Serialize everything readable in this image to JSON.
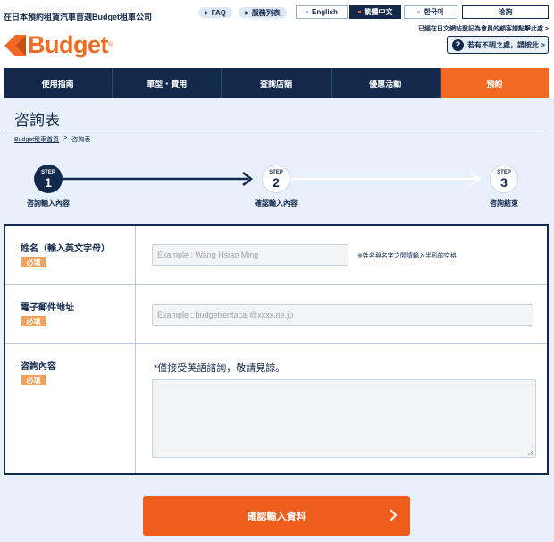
{
  "header": {
    "tagline": "在日本預約租賃汽車首選Budget租車公司",
    "faq_label": "FAQ",
    "service_list_label": "服務列表",
    "languages": [
      {
        "label": "English",
        "active": false
      },
      {
        "label": "繁體中文",
        "active": true
      },
      {
        "label": "한국어",
        "active": false
      }
    ],
    "inquiry_label": "洽詢",
    "member_link": "已經在日文網站登記為會員的顧客請點擊此處 >",
    "help_label": "若有不明之處，請按此 >",
    "logo_text": "Budget",
    "logo_reg": "®"
  },
  "nav": {
    "items": [
      {
        "label": "使用指南",
        "active": false
      },
      {
        "label": "車型・費用",
        "active": false
      },
      {
        "label": "查詢店舖",
        "active": false
      },
      {
        "label": "優惠活動",
        "active": false
      },
      {
        "label": "預約",
        "active": true
      }
    ]
  },
  "page": {
    "title": "咨詢表",
    "breadcrumb": {
      "home": "Budget租車首頁",
      "separator": ">",
      "current": "咨詢表"
    }
  },
  "stepper": {
    "steps": [
      {
        "label": "STEP",
        "number": "1",
        "name": "咨詢輸入內容",
        "state": "active"
      },
      {
        "label": "STEP",
        "number": "2",
        "name": "確認輸入內容",
        "state": "idle"
      },
      {
        "label": "STEP",
        "number": "3",
        "name": "咨詢結束",
        "state": "idle"
      }
    ]
  },
  "form": {
    "required_badge": "必填",
    "name": {
      "label": "姓名（輸入英文字母）",
      "placeholder": "Example : Wang Hsiao Ming",
      "hint": "※姓名與名字之間請輸入半形的空格"
    },
    "email": {
      "label": "電子郵件地址",
      "placeholder": "Example : budgetrentacar@xxxx.ne.jp"
    },
    "inquiry": {
      "label": "咨詢內容",
      "note": "*僅接受英語諮詢，敬請見諒。"
    }
  },
  "submit": {
    "label": "確認輸入資料"
  },
  "colors": {
    "navy": "#13294b",
    "orange": "#f26a21",
    "badge": "#f5a05a",
    "background": "#e8f1fb"
  }
}
